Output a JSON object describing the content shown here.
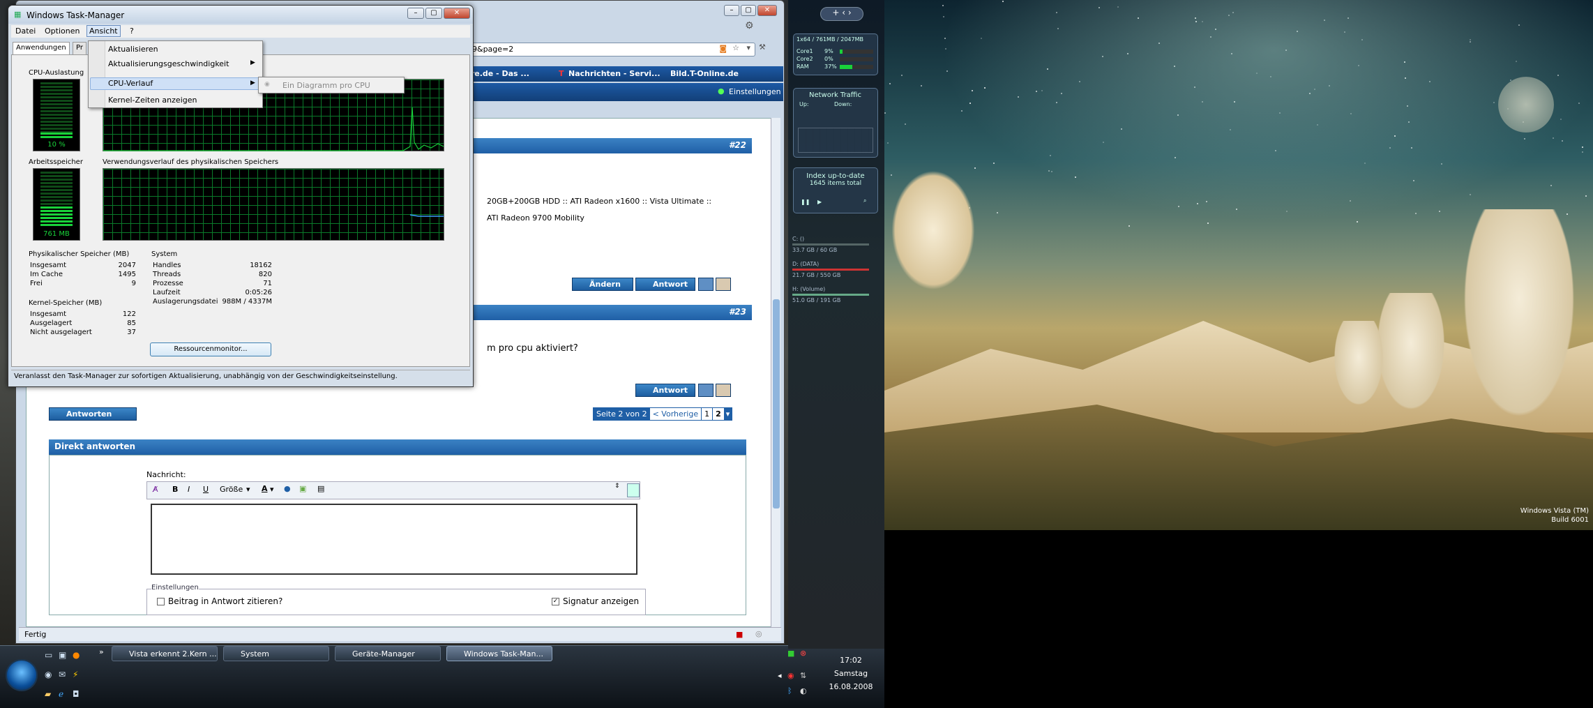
{
  "task_manager": {
    "title": "Windows Task-Manager",
    "menu": [
      "Datei",
      "Optionen",
      "Ansicht",
      "?"
    ],
    "tabs": [
      "Anwendungen",
      "Pr"
    ],
    "cpu_usage_label": "CPU-Auslastung",
    "cpu_percent": "10 %",
    "cpu_percent_value": 10,
    "mem_label": "Arbeitsspeicher",
    "mem_value": "761 MB",
    "mem_fraction": 0.37,
    "mem_history_label": "Verwendungsverlauf des physikalischen Speichers",
    "physical_title": "Physikalischer Speicher (MB)",
    "physical": [
      {
        "label": "Insgesamt",
        "value": "2047"
      },
      {
        "label": "Im Cache",
        "value": "1495"
      },
      {
        "label": "Frei",
        "value": "9"
      }
    ],
    "kernel_title": "Kernel-Speicher (MB)",
    "kernel": [
      {
        "label": "Insgesamt",
        "value": "122"
      },
      {
        "label": "Ausgelagert",
        "value": "85"
      },
      {
        "label": "Nicht ausgelagert",
        "value": "37"
      }
    ],
    "system_title": "System",
    "system": [
      {
        "label": "Handles",
        "value": "18162"
      },
      {
        "label": "Threads",
        "value": "820"
      },
      {
        "label": "Prozesse",
        "value": "71"
      },
      {
        "label": "Laufzeit",
        "value": "0:05:26"
      },
      {
        "label": "Auslagerungsdatei",
        "value": "988M / 4337M"
      }
    ],
    "resmon_button": "Ressourcenmonitor...",
    "status_text": "Veranlasst den Task-Manager zur sofortigen Aktualisierung, unabhängig von der Geschwindigkeitseinstellung."
  },
  "ansicht_menu": {
    "items": [
      "Aktualisieren",
      "Aktualisierungsgeschwindigkeit",
      "CPU-Verlauf",
      "Kernel-Zeiten anzeigen"
    ],
    "submenu_item": "Ein Diagramm pro CPU"
  },
  "browser": {
    "url_fragment": "09&page=2",
    "bookmarks": [
      "ure.de - Das ...",
      "Nachrichten - Servi...",
      "Bild.T-Online.de"
    ],
    "settings_link": "Einstellungen",
    "post22_number": "#22",
    "post22_line1": "20GB+200GB HDD :: ATI Radeon x1600 :: Vista Ultimate ::",
    "post22_line2": "ATI Radeon 9700 Mobility",
    "edit_button": "Ändern",
    "reply_button": "Antwort",
    "post23_number": "#23",
    "post23_text": "m pro cpu aktiviert?",
    "answer_button": "Antworten",
    "pagination": {
      "label": "Seite 2 von 2",
      "prev": "< Vorherige",
      "pages": [
        "1",
        "2"
      ]
    },
    "direct_reply_title": "Direkt antworten",
    "message_label": "Nachricht:",
    "font_size_select": "Größe",
    "settings_group": "Einstellungen",
    "quote_checkbox": "Beitrag in Antwort zitieren?",
    "quote_checked": false,
    "signature_checkbox": "Signatur anzeigen",
    "signature_checked": true,
    "status_bar": "Fertig"
  },
  "taskbar": {
    "buttons": [
      "Vista erkennt 2.Kern ...",
      "System",
      "Geräte-Manager",
      "Windows Task-Man..."
    ],
    "time": "17:02",
    "day": "Samstag",
    "date": "16.08.2008"
  },
  "sidebar": {
    "cpu_header": "1x64 / 761MB / 2047MB",
    "cores": [
      {
        "label": "Core1",
        "value": "9%",
        "fraction": 0.09
      },
      {
        "label": "Core2",
        "value": "0%",
        "fraction": 0.0
      },
      {
        "label": "RAM",
        "value": "37%",
        "fraction": 0.37
      }
    ],
    "network_title": "Network Traffic",
    "up_label": "Up:",
    "down_label": "Down:",
    "index_text": "Index up-to-date",
    "index_items": "1645 items total",
    "drives": [
      {
        "label": "C: ()",
        "detail": "33.7 GB / 60 GB"
      },
      {
        "label": "D: (DATA)",
        "detail": "21.7 GB / 550 GB"
      },
      {
        "label": "H: (Volume)",
        "detail": "51.0 GB / 191 GB"
      }
    ]
  },
  "watermark": {
    "line1": "Windows Vista (TM)",
    "line2": "Build 6001"
  },
  "colors": {
    "graph_green": "#0a7a2a",
    "meter_green": "#19d23a",
    "post_header_blue": "#1f5fa6",
    "taskbar": "#1b2530"
  }
}
